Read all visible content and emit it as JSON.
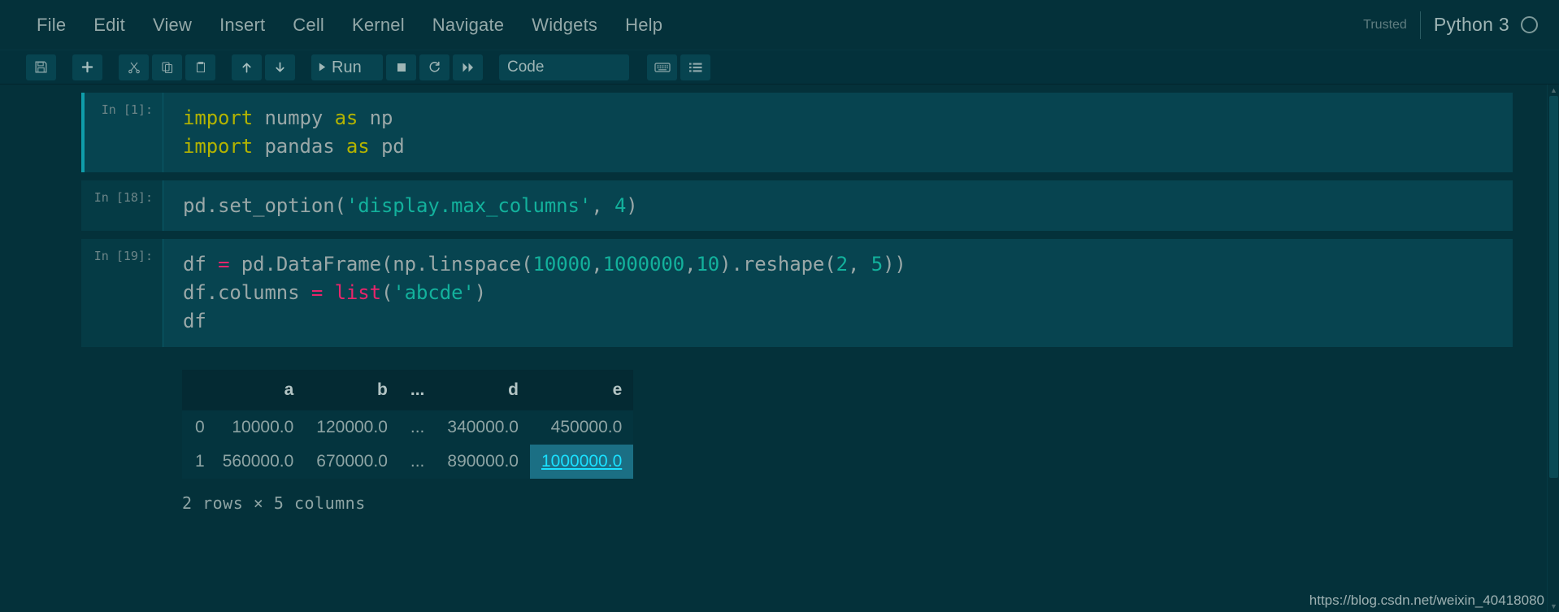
{
  "menubar": {
    "items": [
      {
        "label": "File"
      },
      {
        "label": "Edit"
      },
      {
        "label": "View"
      },
      {
        "label": "Insert"
      },
      {
        "label": "Cell"
      },
      {
        "label": "Kernel"
      },
      {
        "label": "Navigate"
      },
      {
        "label": "Widgets"
      },
      {
        "label": "Help"
      }
    ],
    "trusted": "Trusted",
    "kernel_name": "Python 3",
    "kernel_status_icon": "circle-idle-icon"
  },
  "toolbar": {
    "save_icon": "save-icon",
    "add_icon": "plus-icon",
    "cut_icon": "scissors-icon",
    "copy_icon": "copy-icon",
    "paste_icon": "paste-icon",
    "move_up_icon": "arrow-up-icon",
    "move_down_icon": "arrow-down-icon",
    "run_label": "Run",
    "run_icon": "play-icon",
    "stop_icon": "stop-square-icon",
    "restart_icon": "restart-circular-arrow-icon",
    "fastforward_icon": "fast-forward-icon",
    "celltype_value": "Code",
    "command_palette_icon": "keyboard-icon",
    "toc_icon": "list-lines-icon"
  },
  "notebook": {
    "cells": [
      {
        "prompt": "In [1]:",
        "selected": true,
        "lines": [
          [
            {
              "t": "import",
              "c": "kw"
            },
            {
              "t": " numpy ",
              "c": "pl"
            },
            {
              "t": "as",
              "c": "kw"
            },
            {
              "t": " np",
              "c": "pl"
            }
          ],
          [
            {
              "t": "import",
              "c": "kw"
            },
            {
              "t": " pandas ",
              "c": "pl"
            },
            {
              "t": "as",
              "c": "kw"
            },
            {
              "t": " pd",
              "c": "pl"
            }
          ]
        ]
      },
      {
        "prompt": "In [18]:",
        "selected": false,
        "lines": [
          [
            {
              "t": "pd.set_option(",
              "c": "pl"
            },
            {
              "t": "'display.max_columns'",
              "c": "str"
            },
            {
              "t": ", ",
              "c": "pl"
            },
            {
              "t": "4",
              "c": "num"
            },
            {
              "t": ")",
              "c": "pl"
            }
          ]
        ]
      },
      {
        "prompt": "In [19]:",
        "selected": false,
        "lines": [
          [
            {
              "t": "df ",
              "c": "pl"
            },
            {
              "t": "=",
              "c": "op"
            },
            {
              "t": " pd.DataFrame(np.linspace(",
              "c": "pl"
            },
            {
              "t": "10000",
              "c": "num"
            },
            {
              "t": ",",
              "c": "pl"
            },
            {
              "t": "1000000",
              "c": "num"
            },
            {
              "t": ",",
              "c": "pl"
            },
            {
              "t": "10",
              "c": "num"
            },
            {
              "t": ").reshape(",
              "c": "pl"
            },
            {
              "t": "2",
              "c": "num"
            },
            {
              "t": ", ",
              "c": "pl"
            },
            {
              "t": "5",
              "c": "num"
            },
            {
              "t": "))",
              "c": "pl"
            }
          ],
          [
            {
              "t": "df.columns ",
              "c": "pl"
            },
            {
              "t": "=",
              "c": "op"
            },
            {
              "t": " ",
              "c": "pl"
            },
            {
              "t": "list",
              "c": "bi"
            },
            {
              "t": "(",
              "c": "pl"
            },
            {
              "t": "'abcde'",
              "c": "str"
            },
            {
              "t": ")",
              "c": "pl"
            }
          ],
          [
            {
              "t": "df",
              "c": "pl"
            }
          ]
        ]
      }
    ],
    "output": {
      "table": {
        "headers": [
          "",
          "a",
          "b",
          "...",
          "d",
          "e"
        ],
        "rows": [
          {
            "index": "0",
            "cells": [
              "10000.0",
              "120000.0",
              "...",
              "340000.0",
              "450000.0"
            ],
            "selected_cell": -1
          },
          {
            "index": "1",
            "cells": [
              "560000.0",
              "670000.0",
              "...",
              "890000.0",
              "1000000.0"
            ],
            "selected_cell": 4
          }
        ]
      },
      "footer": "2 rows × 5 columns"
    }
  },
  "watermark": "https://blog.csdn.net/weixin_40418080"
}
